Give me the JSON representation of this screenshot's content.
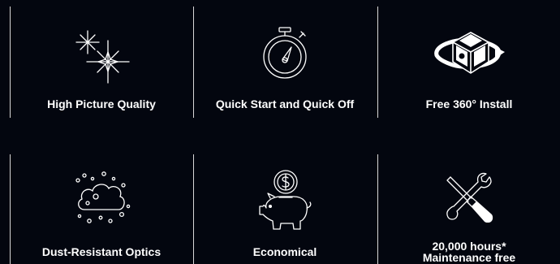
{
  "features": [
    {
      "label": "High Picture Quality",
      "icon": "sparkle-icon"
    },
    {
      "label": "Quick Start and Quick Off",
      "icon": "stopwatch-icon"
    },
    {
      "label": "Free 360° Install",
      "icon": "rotating-projector-icon"
    },
    {
      "label": "Dust-Resistant Optics",
      "icon": "dust-cloud-icon"
    },
    {
      "label": "Economical",
      "icon": "piggy-bank-icon"
    },
    {
      "label": "20,000 hours*",
      "label_line2": "Maintenance free",
      "icon": "tools-icon"
    }
  ],
  "colors": {
    "background": "#03060f",
    "text": "#ffffff",
    "divider": "#d8d8d8"
  }
}
